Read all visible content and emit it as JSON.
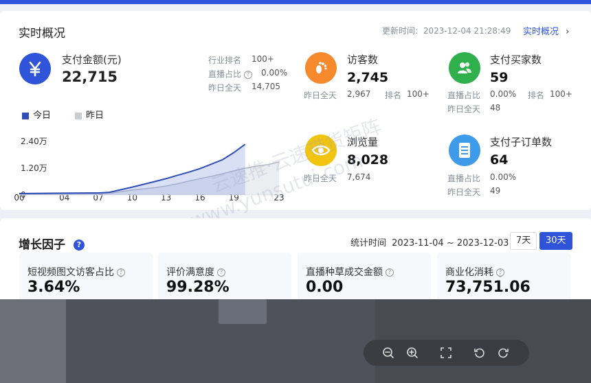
{
  "overview": {
    "title": "实时概况",
    "updated_label": "更新时间:",
    "updated_time": "2023-12-04 21:28:49",
    "link_label": "实时概况"
  },
  "pay_amount": {
    "icon": "yen-icon",
    "label": "支付金额(元)",
    "value": "22,715",
    "rank_label": "行业排名",
    "rank_value": "100+",
    "live_label": "直播占比",
    "live_value": "0.00%",
    "yesterday_label": "昨日全天",
    "yesterday_value": "14,705"
  },
  "legend": {
    "today": "今日",
    "yesterday": "昨日"
  },
  "chart_data": {
    "type": "area",
    "title": "",
    "x_ticks": [
      "00",
      "04",
      "07",
      "10",
      "13",
      "16",
      "19",
      "23"
    ],
    "y_ticks": [
      "2.40万",
      "1.20万",
      "0"
    ],
    "ylim": [
      0,
      24000
    ],
    "xlim": [
      0,
      23
    ],
    "series": [
      {
        "name": "今日",
        "color": "#2f4fb5",
        "x": [
          0,
          4,
          7,
          8,
          10,
          12,
          13,
          14,
          15,
          16,
          17,
          18,
          19,
          20
        ],
        "y": [
          600,
          800,
          900,
          1200,
          3500,
          6000,
          7300,
          8800,
          10200,
          11800,
          13800,
          15800,
          19000,
          22715
        ]
      },
      {
        "name": "昨日",
        "color": "#b8bcc6",
        "x": [
          0,
          4,
          7,
          8,
          10,
          12,
          13,
          14,
          15,
          16,
          17,
          18,
          19,
          20,
          21,
          22,
          23
        ],
        "y": [
          400,
          500,
          600,
          700,
          2200,
          3200,
          4000,
          5000,
          6200,
          7300,
          8300,
          9500,
          10800,
          12000,
          12900,
          13600,
          14705
        ]
      }
    ]
  },
  "visitors": {
    "icon": "footprint-icon",
    "label": "访客数",
    "value": "2,745",
    "yesterday_label": "昨日全天",
    "yesterday_value": "2,967",
    "rank_label": "排名",
    "rank_value": "100+"
  },
  "buyers": {
    "icon": "users-icon",
    "label": "支付买家数",
    "value": "59",
    "live_label": "直播占比",
    "live_value": "0.00%",
    "rank_label": "排名",
    "rank_value": "100+",
    "yesterday_label": "昨日全天",
    "yesterday_value": "48"
  },
  "views": {
    "icon": "eye-icon",
    "label": "浏览量",
    "value": "8,028",
    "yesterday_label": "昨日全天",
    "yesterday_value": "7,674"
  },
  "orders": {
    "icon": "document-icon",
    "label": "支付子订单数",
    "value": "64",
    "live_label": "直播占比",
    "live_value": "0.00%",
    "yesterday_label": "昨日全天",
    "yesterday_value": "49"
  },
  "watermark": {
    "line1": "云速推·云速带货矩阵",
    "line2": "www.yunsutui.com"
  },
  "growth": {
    "title": "增长因子",
    "stat_label": "统计时间",
    "stat_range": "2023-11-04 ~ 2023-12-03",
    "btn_7": "7天",
    "btn_30": "30天",
    "factors": [
      {
        "label": "短视频图文访客占比",
        "value": "3.64%"
      },
      {
        "label": "评价满意度",
        "value": "99.28%"
      },
      {
        "label": "直播种草成交金额",
        "value": "0.00"
      },
      {
        "label": "商业化消耗",
        "value": "73,751.06"
      }
    ]
  },
  "toolbar": {
    "icons": [
      "zoom-out-icon",
      "zoom-in-icon",
      "fullscreen-icon",
      "rotate-left-icon",
      "rotate-right-icon"
    ]
  },
  "colors": {
    "primary": "#2f54d9",
    "yen_bg": "#2f54d9",
    "visitors_bg": "#f7892d",
    "buyers_bg": "#2fb04d",
    "views_bg": "#f1c40f",
    "orders_bg": "#3d9be9"
  }
}
